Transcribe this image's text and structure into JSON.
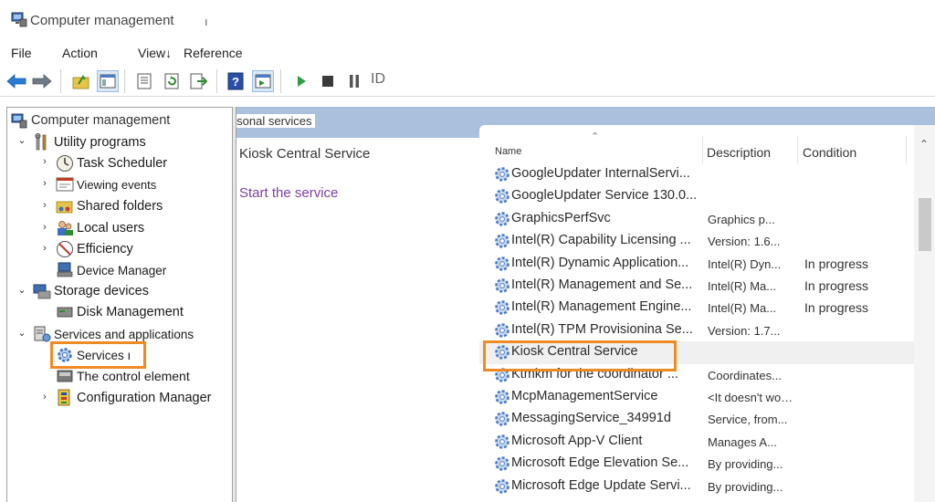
{
  "window": {
    "title": "Computer management",
    "title_caret": "ı"
  },
  "menu": [
    "File",
    "Action",
    "View↓",
    "Reference"
  ],
  "toolbar": {
    "label": "ID"
  },
  "tree": {
    "root": "Computer management",
    "header_tab": "ı(Personal services",
    "items": [
      {
        "label": "Utility programs"
      },
      {
        "label": "Task Scheduler"
      },
      {
        "label": "Viewing events"
      },
      {
        "label": "Shared folders"
      },
      {
        "label": "Local users"
      },
      {
        "label": "Efficiency"
      },
      {
        "label": "Device Manager"
      },
      {
        "label": "Storage devices"
      },
      {
        "label": "Disk Management"
      },
      {
        "label": "Services and applications"
      },
      {
        "label": "Services ı"
      },
      {
        "label": "The control element"
      },
      {
        "label": "Configuration Manager"
      }
    ]
  },
  "info": {
    "title": "Kiosk Central Service",
    "action_link": "Start the service"
  },
  "list": {
    "columns": {
      "name": "Name",
      "description": "Description",
      "condition": "Condition"
    },
    "rows": [
      {
        "name": "GoogleUpdater InternalServi...",
        "description": "",
        "condition": ""
      },
      {
        "name": "GoogleUpdater Service 130.0...",
        "description": "",
        "condition": ""
      },
      {
        "name": "GraphicsPerfSvc",
        "description": "Graphics p...",
        "condition": ""
      },
      {
        "name": "Intel(R) Capability Licensing ...",
        "description": "Version: 1.6...",
        "condition": ""
      },
      {
        "name": "Intel(R) Dynamic Application...",
        "description": "Intel(R) Dyn...",
        "condition": "In progress"
      },
      {
        "name": "Intel(R) Management and Se...",
        "description": "Intel(R) Ma...",
        "condition": "In progress"
      },
      {
        "name": "Intel(R) Management Engine...",
        "description": "Intel(R) Ma...",
        "condition": "In progress"
      },
      {
        "name": "Intel(R) TPM Provisionina Se...",
        "description": "Version: 1.7...",
        "condition": ""
      },
      {
        "name": "Kiosk Central Service",
        "description": "",
        "condition": ""
      },
      {
        "name": "Ktmkm for the coordinator ...",
        "description": "Coordinates...",
        "condition": ""
      },
      {
        "name": "McpManagementService",
        "description": "<It doesn't work...",
        "condition": ""
      },
      {
        "name": "MessagingService_34991d",
        "description": "Service, from...",
        "condition": ""
      },
      {
        "name": "Microsoft App-V Client",
        "description": "Manages A...",
        "condition": ""
      },
      {
        "name": "Microsoft Edge Elevation Se...",
        "description": "By providing...",
        "condition": ""
      },
      {
        "name": "Microsoft Edge Update Servi...",
        "description": "By providing...",
        "condition": ""
      }
    ]
  }
}
